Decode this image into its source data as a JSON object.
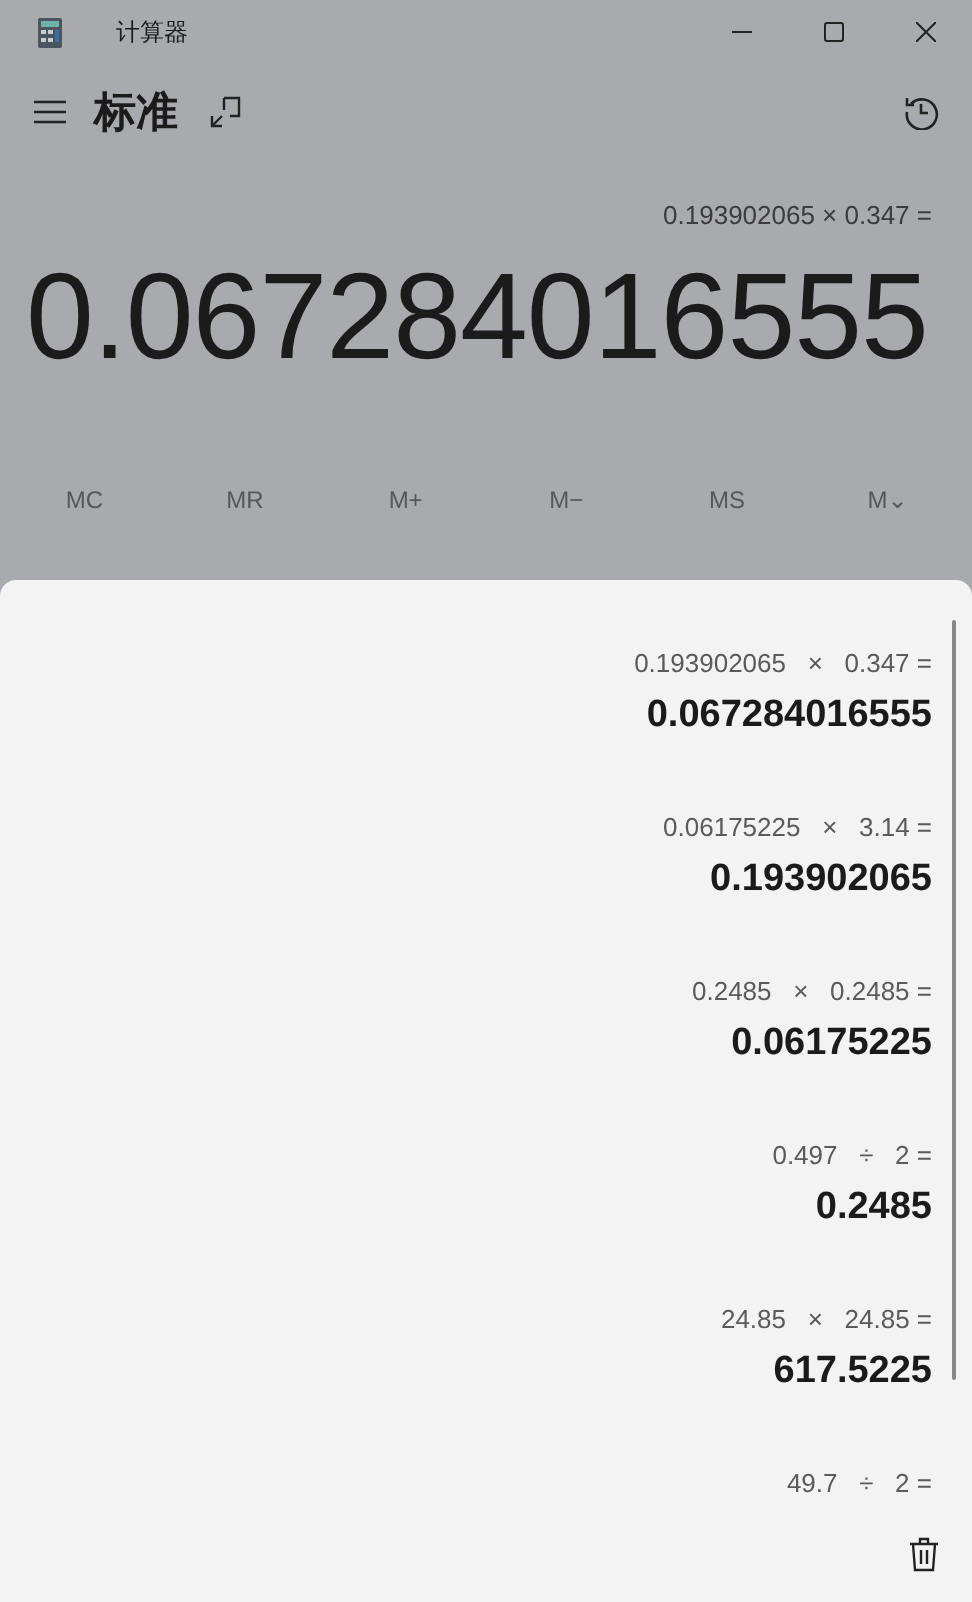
{
  "window": {
    "title": "计算器"
  },
  "header": {
    "mode": "标准"
  },
  "display": {
    "expression": "0.193902065 × 0.347 =",
    "value": "0.067284016555"
  },
  "memory_buttons": [
    {
      "label": "MC"
    },
    {
      "label": "MR"
    },
    {
      "label": "M+"
    },
    {
      "label": "M−"
    },
    {
      "label": "MS"
    },
    {
      "label": "M⌄"
    }
  ],
  "history": [
    {
      "expression": "0.193902065   ×   0.347 =",
      "result": "0.067284016555"
    },
    {
      "expression": "0.06175225   ×   3.14 =",
      "result": "0.193902065"
    },
    {
      "expression": "0.2485   ×   0.2485 =",
      "result": "0.06175225"
    },
    {
      "expression": "0.497   ÷   2 =",
      "result": "0.2485"
    },
    {
      "expression": "24.85   ×   24.85 =",
      "result": "617.5225"
    },
    {
      "expression": "49.7   ÷   2 ="
    }
  ]
}
